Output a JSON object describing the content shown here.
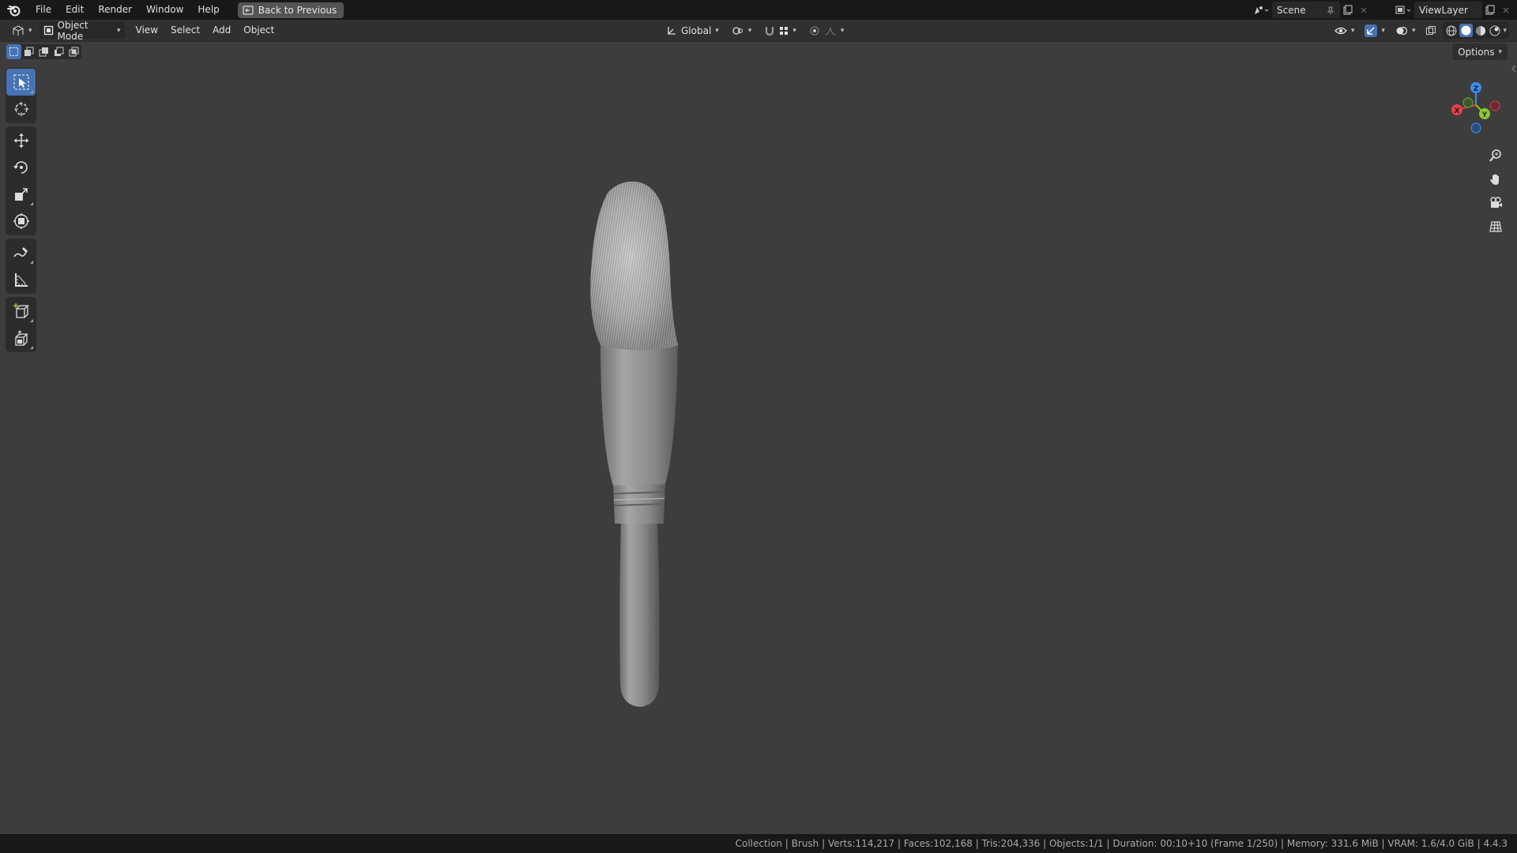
{
  "topbar": {
    "menus": [
      "File",
      "Edit",
      "Render",
      "Window",
      "Help"
    ],
    "back_button": "Back to Previous",
    "scene_name": "Scene",
    "view_layer_name": "ViewLayer"
  },
  "viewport_header": {
    "mode": "Object Mode",
    "menus": [
      "View",
      "Select",
      "Add",
      "Object"
    ],
    "transform_orientation": "Global"
  },
  "viewport": {
    "options_label": "Options",
    "gizmo_axes": {
      "x": "X",
      "y": "Y",
      "z": "Z"
    },
    "object_name": "Brush"
  },
  "toolbar": {
    "tools": [
      "select-box-icon",
      "cursor-icon",
      "move-icon",
      "rotate-icon",
      "scale-icon",
      "transform-icon",
      "annotate-icon",
      "measure-icon",
      "add-cube-icon",
      "extrude-icon"
    ]
  },
  "statusbar": {
    "text": "Collection | Brush | Verts:114,217 | Faces:102,168 | Tris:204,336 | Objects:1/1 | Duration: 00:10+10 (Frame 1/250) | Memory: 331.6 MiB | VRAM: 1.6/4.0 GiB | 4.4.3"
  },
  "colors": {
    "accent": "#4772b3",
    "axis_x": "#e2424e",
    "axis_y": "#8bc934",
    "axis_z": "#3c8ee8",
    "viewport_bg": "#3d3d3d"
  }
}
